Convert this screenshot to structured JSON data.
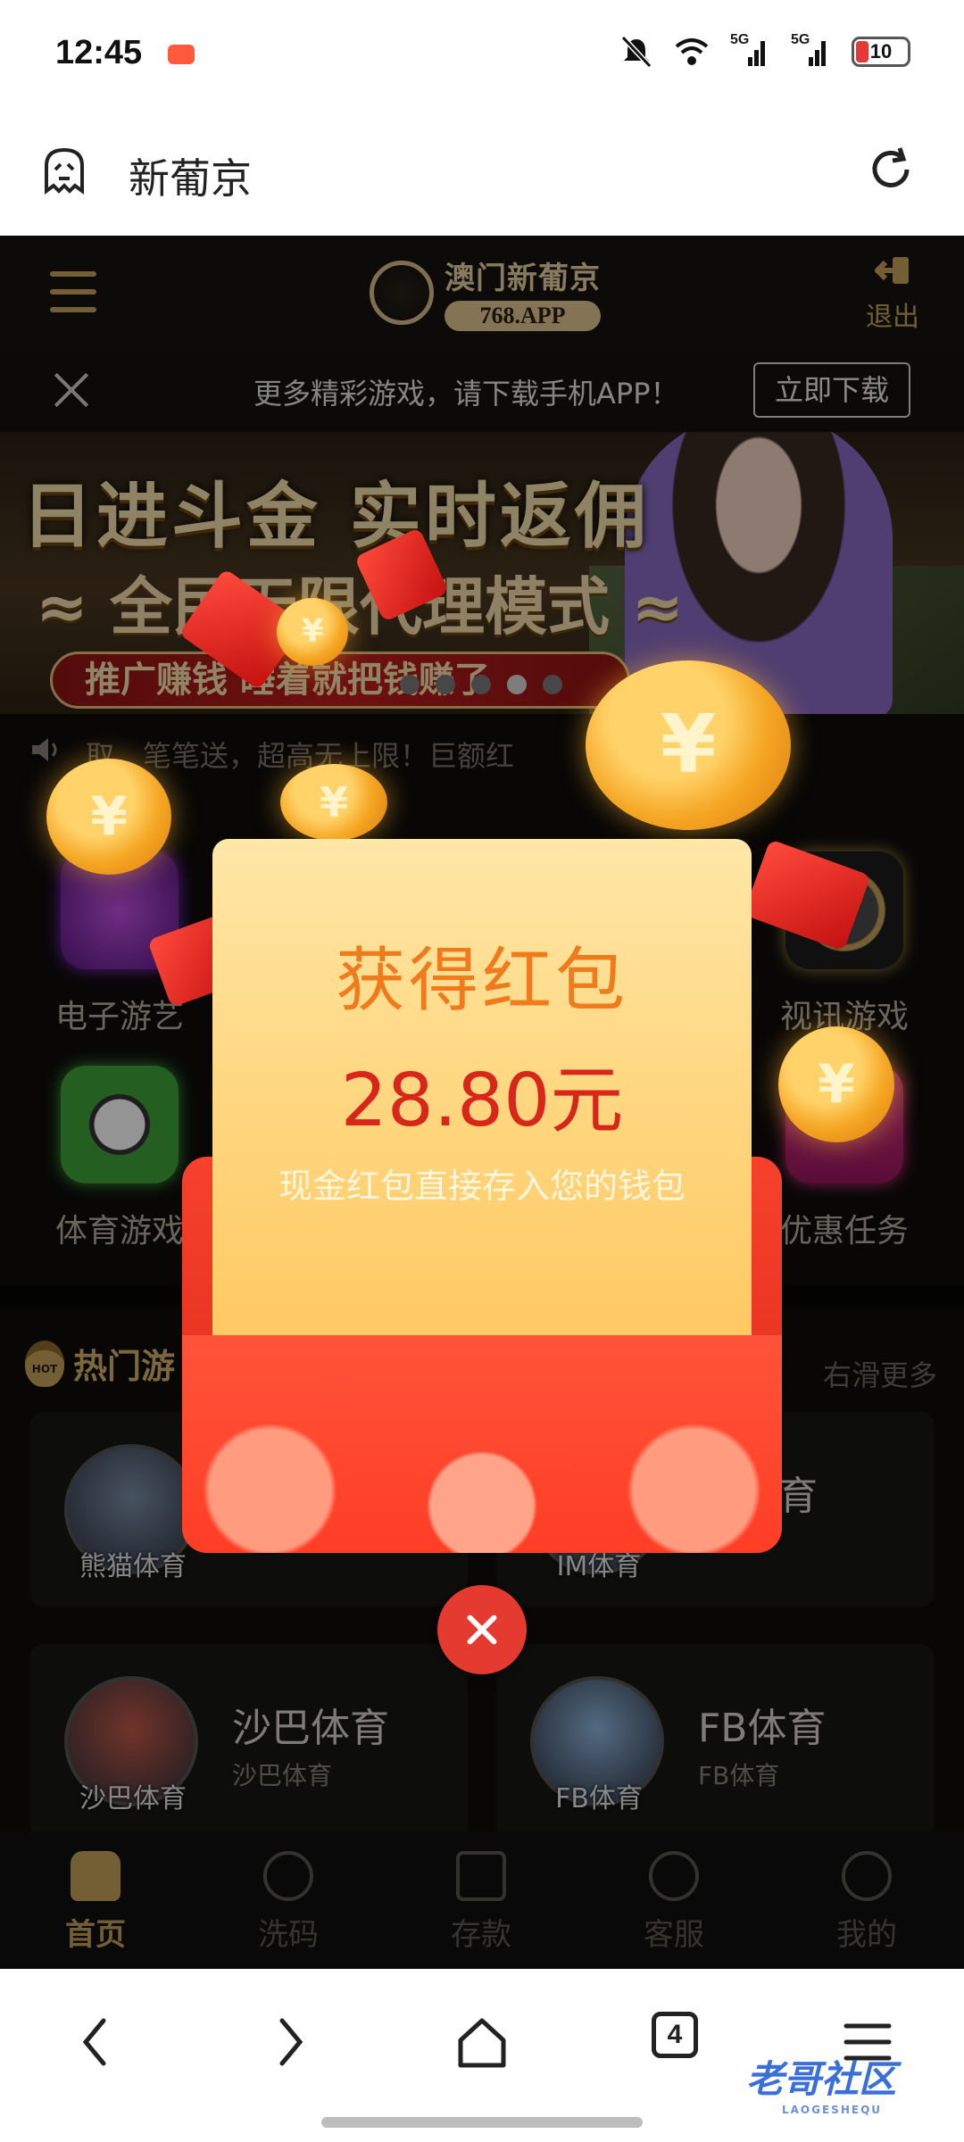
{
  "status_bar": {
    "time": "12:45",
    "battery": "10",
    "signal1": "5G",
    "signal2": "5G"
  },
  "browser": {
    "title": "新葡京"
  },
  "site": {
    "logo_text": "澳门新葡京",
    "logo_domain": "768.APP",
    "logout_label": "退出"
  },
  "download_bar": {
    "text": "更多精彩游戏，请下载手机APP！",
    "button": "立即下载"
  },
  "banner": {
    "headline": "日进斗金 实时返佣",
    "subline": "≈ 全民无限代理模式 ≈",
    "pill": "推广赚钱 睡着就把钱赚了",
    "slide_count": 5,
    "active_slide": 4
  },
  "marquee": {
    "text": "取，笔笔送，超高无上限！巨额红"
  },
  "categories": [
    {
      "label": "电子游艺",
      "icon": "slot-machine-icon"
    },
    {
      "label": "视讯游戏",
      "icon": "roulette-icon"
    },
    {
      "label": "体育游戏",
      "icon": "soccer-ball-icon"
    },
    {
      "label": "优惠任务",
      "icon": "gift-icon"
    }
  ],
  "hot_section": {
    "title": "热门游",
    "more": "右滑更多",
    "badge": "HOT"
  },
  "game_cards": [
    {
      "name": "",
      "sub": "",
      "avatar_label": "熊猫体育"
    },
    {
      "name": "育",
      "sub": "",
      "avatar_label": "IM体育"
    },
    {
      "name": "沙巴体育",
      "sub": "沙巴体育",
      "avatar_label": "沙巴体育"
    },
    {
      "name": "FB体育",
      "sub": "FB体育",
      "avatar_label": "FB体育"
    }
  ],
  "tabbar": [
    {
      "label": "首页",
      "icon": "home-icon",
      "active": true
    },
    {
      "label": "洗码",
      "icon": "chip-icon",
      "active": false
    },
    {
      "label": "存款",
      "icon": "deposit-icon",
      "active": false
    },
    {
      "label": "客服",
      "icon": "support-icon",
      "active": false
    },
    {
      "label": "我的",
      "icon": "profile-icon",
      "active": false
    }
  ],
  "red_packet": {
    "title": "获得红包",
    "amount": "28.80元",
    "note": "现金红包直接存入您的钱包"
  },
  "browser_toolbar": {
    "tab_count": "4"
  },
  "watermark": {
    "text": "老哥社区",
    "sub": "LAOGESHEQU"
  },
  "colors": {
    "gold": "#c8a25a",
    "packet_red": "#e53a2f",
    "amount_red": "#d9261a",
    "title_orange": "#f07b1d"
  }
}
